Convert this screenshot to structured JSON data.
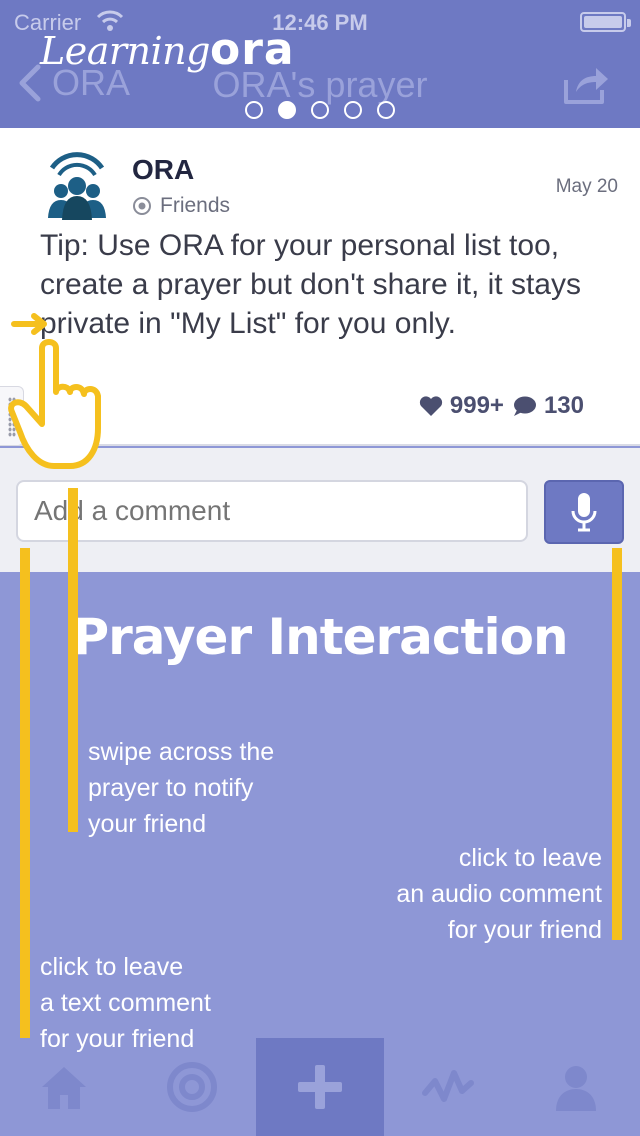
{
  "status_bar": {
    "carrier": "Carrier",
    "time": "12:46 PM",
    "battery_level": 1.0
  },
  "brand": {
    "learning": "Learning",
    "ora": "ora"
  },
  "nav": {
    "back_label": "ORA",
    "title": "ORA's prayer",
    "page_count": 5,
    "active_page": 2
  },
  "post": {
    "author": "ORA",
    "audience": "Friends",
    "date": "May 20",
    "text": "Tip: Use ORA for your personal list too, create a prayer but don't share it, it stays private in \"My List\" for you only.",
    "likes": "999+",
    "comments": "130"
  },
  "comment_input": {
    "placeholder": "Add a comment"
  },
  "tutorial": {
    "heading": "Prayer Interaction",
    "swipe_hint": "swipe across the\nprayer to notify\nyour friend",
    "audio_hint": "click to leave\nan audio comment\nfor your friend",
    "text_hint": "click to leave\na text comment\nfor your friend"
  },
  "tabs": [
    {
      "icon": "home-icon"
    },
    {
      "icon": "target-icon"
    },
    {
      "icon": "plus-icon",
      "active": true
    },
    {
      "icon": "activity-icon"
    },
    {
      "icon": "person-icon"
    }
  ],
  "colors": {
    "header": "#6e79c3",
    "overlay": "#8e97d6",
    "guide": "#f5c01e",
    "avatar": "#1d5f86"
  }
}
